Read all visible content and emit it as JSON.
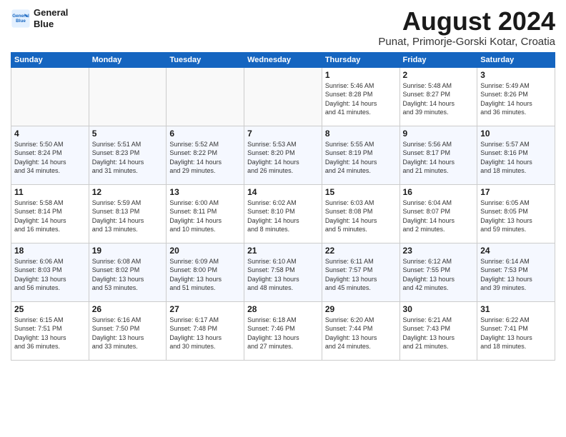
{
  "header": {
    "logo_line1": "General",
    "logo_line2": "Blue",
    "month": "August 2024",
    "location": "Punat, Primorje-Gorski Kotar, Croatia"
  },
  "weekdays": [
    "Sunday",
    "Monday",
    "Tuesday",
    "Wednesday",
    "Thursday",
    "Friday",
    "Saturday"
  ],
  "weeks": [
    [
      {
        "day": "",
        "info": ""
      },
      {
        "day": "",
        "info": ""
      },
      {
        "day": "",
        "info": ""
      },
      {
        "day": "",
        "info": ""
      },
      {
        "day": "1",
        "info": "Sunrise: 5:46 AM\nSunset: 8:28 PM\nDaylight: 14 hours\nand 41 minutes."
      },
      {
        "day": "2",
        "info": "Sunrise: 5:48 AM\nSunset: 8:27 PM\nDaylight: 14 hours\nand 39 minutes."
      },
      {
        "day": "3",
        "info": "Sunrise: 5:49 AM\nSunset: 8:26 PM\nDaylight: 14 hours\nand 36 minutes."
      }
    ],
    [
      {
        "day": "4",
        "info": "Sunrise: 5:50 AM\nSunset: 8:24 PM\nDaylight: 14 hours\nand 34 minutes."
      },
      {
        "day": "5",
        "info": "Sunrise: 5:51 AM\nSunset: 8:23 PM\nDaylight: 14 hours\nand 31 minutes."
      },
      {
        "day": "6",
        "info": "Sunrise: 5:52 AM\nSunset: 8:22 PM\nDaylight: 14 hours\nand 29 minutes."
      },
      {
        "day": "7",
        "info": "Sunrise: 5:53 AM\nSunset: 8:20 PM\nDaylight: 14 hours\nand 26 minutes."
      },
      {
        "day": "8",
        "info": "Sunrise: 5:55 AM\nSunset: 8:19 PM\nDaylight: 14 hours\nand 24 minutes."
      },
      {
        "day": "9",
        "info": "Sunrise: 5:56 AM\nSunset: 8:17 PM\nDaylight: 14 hours\nand 21 minutes."
      },
      {
        "day": "10",
        "info": "Sunrise: 5:57 AM\nSunset: 8:16 PM\nDaylight: 14 hours\nand 18 minutes."
      }
    ],
    [
      {
        "day": "11",
        "info": "Sunrise: 5:58 AM\nSunset: 8:14 PM\nDaylight: 14 hours\nand 16 minutes."
      },
      {
        "day": "12",
        "info": "Sunrise: 5:59 AM\nSunset: 8:13 PM\nDaylight: 14 hours\nand 13 minutes."
      },
      {
        "day": "13",
        "info": "Sunrise: 6:00 AM\nSunset: 8:11 PM\nDaylight: 14 hours\nand 10 minutes."
      },
      {
        "day": "14",
        "info": "Sunrise: 6:02 AM\nSunset: 8:10 PM\nDaylight: 14 hours\nand 8 minutes."
      },
      {
        "day": "15",
        "info": "Sunrise: 6:03 AM\nSunset: 8:08 PM\nDaylight: 14 hours\nand 5 minutes."
      },
      {
        "day": "16",
        "info": "Sunrise: 6:04 AM\nSunset: 8:07 PM\nDaylight: 14 hours\nand 2 minutes."
      },
      {
        "day": "17",
        "info": "Sunrise: 6:05 AM\nSunset: 8:05 PM\nDaylight: 13 hours\nand 59 minutes."
      }
    ],
    [
      {
        "day": "18",
        "info": "Sunrise: 6:06 AM\nSunset: 8:03 PM\nDaylight: 13 hours\nand 56 minutes."
      },
      {
        "day": "19",
        "info": "Sunrise: 6:08 AM\nSunset: 8:02 PM\nDaylight: 13 hours\nand 53 minutes."
      },
      {
        "day": "20",
        "info": "Sunrise: 6:09 AM\nSunset: 8:00 PM\nDaylight: 13 hours\nand 51 minutes."
      },
      {
        "day": "21",
        "info": "Sunrise: 6:10 AM\nSunset: 7:58 PM\nDaylight: 13 hours\nand 48 minutes."
      },
      {
        "day": "22",
        "info": "Sunrise: 6:11 AM\nSunset: 7:57 PM\nDaylight: 13 hours\nand 45 minutes."
      },
      {
        "day": "23",
        "info": "Sunrise: 6:12 AM\nSunset: 7:55 PM\nDaylight: 13 hours\nand 42 minutes."
      },
      {
        "day": "24",
        "info": "Sunrise: 6:14 AM\nSunset: 7:53 PM\nDaylight: 13 hours\nand 39 minutes."
      }
    ],
    [
      {
        "day": "25",
        "info": "Sunrise: 6:15 AM\nSunset: 7:51 PM\nDaylight: 13 hours\nand 36 minutes."
      },
      {
        "day": "26",
        "info": "Sunrise: 6:16 AM\nSunset: 7:50 PM\nDaylight: 13 hours\nand 33 minutes."
      },
      {
        "day": "27",
        "info": "Sunrise: 6:17 AM\nSunset: 7:48 PM\nDaylight: 13 hours\nand 30 minutes."
      },
      {
        "day": "28",
        "info": "Sunrise: 6:18 AM\nSunset: 7:46 PM\nDaylight: 13 hours\nand 27 minutes."
      },
      {
        "day": "29",
        "info": "Sunrise: 6:20 AM\nSunset: 7:44 PM\nDaylight: 13 hours\nand 24 minutes."
      },
      {
        "day": "30",
        "info": "Sunrise: 6:21 AM\nSunset: 7:43 PM\nDaylight: 13 hours\nand 21 minutes."
      },
      {
        "day": "31",
        "info": "Sunrise: 6:22 AM\nSunset: 7:41 PM\nDaylight: 13 hours\nand 18 minutes."
      }
    ]
  ]
}
